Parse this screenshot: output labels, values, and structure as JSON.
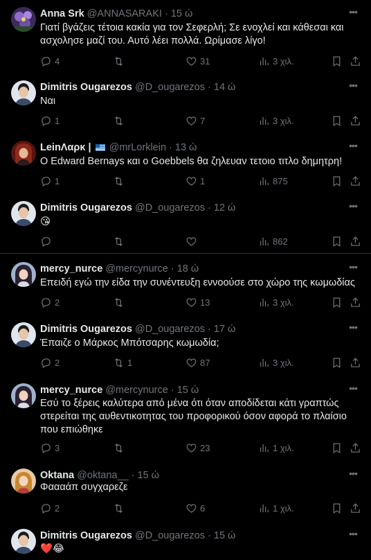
{
  "tweets": [
    {
      "name": "Anna Srk",
      "handle": "@ANNASARAKI",
      "time": "15 ώ",
      "text": "Γιατί βγάζεις τέτοια κακία για τον Σεφερλή; Σε ενοχλεί και κάθεσαι και ασχολησε μαζί του. Αυτό λέει πολλά. Ωρίμασε λίγο!",
      "replies": "4",
      "retweets": "",
      "likes": "31",
      "views": "3 χιλ.",
      "avatar": "flower"
    },
    {
      "name": "Dimitris Ougarezos",
      "handle": "@D_ougarezos",
      "time": "14 ώ",
      "text": "Ναι",
      "replies": "1",
      "retweets": "",
      "likes": "7",
      "views": "3 χιλ.",
      "avatar": "man"
    },
    {
      "name": "LeinΛαρκ |",
      "handle": "@mrLorklein",
      "time": "13 ώ",
      "text": "Ο Edward Bernays και ο Goebbels θα ζηλευαν τετοιο τιτλο δημητρη!",
      "replies": "1",
      "retweets": "",
      "likes": "1",
      "views": "875",
      "avatar": "woman-red"
    },
    {
      "name": "Dimitris Ougarezos",
      "handle": "@D_ougarezos",
      "time": "12 ώ",
      "text": "😘",
      "replies": "",
      "retweets": "",
      "likes": "",
      "views": "862",
      "avatar": "man"
    },
    {
      "name": "mercy_nurce",
      "handle": "@mercynurce",
      "time": "18 ώ",
      "text": "Επειδή εγώ την είδα την συνέντευξη εννοούσε στο χώρο της κωμωδίας",
      "replies": "2",
      "retweets": "",
      "likes": "13",
      "views": "3 χιλ.",
      "avatar": "girl"
    },
    {
      "name": "Dimitris Ougarezos",
      "handle": "@D_ougarezos",
      "time": "17 ώ",
      "text": "Έπαιζε ο Μάρκος Μπότσαρης κωμωδία;",
      "replies": "2",
      "retweets": "1",
      "likes": "87",
      "views": "3 χιλ.",
      "avatar": "man"
    },
    {
      "name": "mercy_nurce",
      "handle": "@mercynurce",
      "time": "15 ώ",
      "text": "Εσύ το ξέρεις καλύτερα από μένα ότι όταν αποδίδεται κάτι γραπτώς στερείται της αυθεντικοτητας του προφορικού όσον αφορά το πλαίσιο που επιώθηκε",
      "replies": "3",
      "retweets": "",
      "likes": "23",
      "views": "1 χιλ.",
      "avatar": "girl"
    },
    {
      "name": "Oktana",
      "handle": "@oktana__",
      "time": "15 ώ",
      "text": "Φαααάπ συγχαρεζε",
      "replies": "2",
      "retweets": "",
      "likes": "6",
      "views": "1 χιλ.",
      "avatar": "woman-blonde"
    },
    {
      "name": "Dimitris Ougarezos",
      "handle": "@D_ougarezos",
      "time": "15 ώ",
      "text": "❤️😂",
      "replies": "",
      "retweets": "",
      "likes": "",
      "views": "",
      "avatar": "man"
    }
  ],
  "icons": {
    "reply": "reply-icon",
    "retweet": "retweet-icon",
    "like": "heart-icon",
    "views": "views-icon",
    "bookmark": "bookmark-icon",
    "share": "share-icon",
    "more": "more-icon"
  },
  "colors": {
    "background": "#000000",
    "text": "#e7e9ea",
    "muted": "#71767b",
    "separator": "#2f3336"
  }
}
